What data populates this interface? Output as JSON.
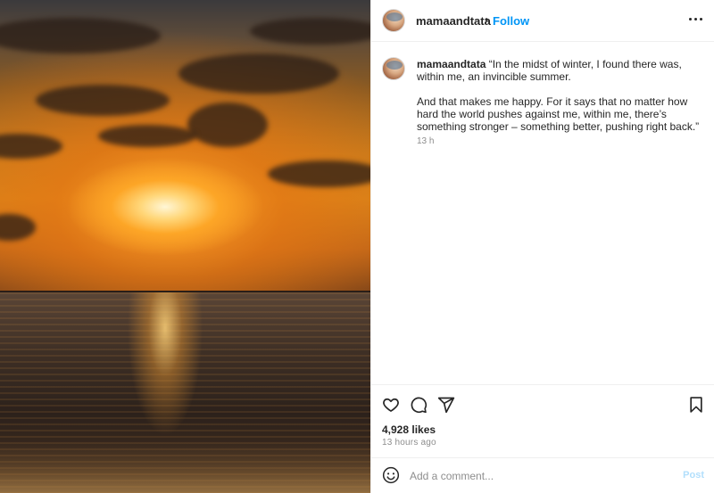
{
  "photo": {
    "alt": "Sunset over the ocean"
  },
  "header": {
    "username": "mamaandtata",
    "separator": "•",
    "follow_label": "Follow",
    "more_icon": "more-horizontal-icon"
  },
  "caption": {
    "username": "mamaandtata",
    "text": " “In the midst of winter, I found there was, within me, an invincible summer.\n\nAnd that makes me happy. For it says that no matter how hard the world pushes against me, within me, there’s something stronger – something better, pushing right back.”",
    "time": "13 h"
  },
  "actions": {
    "like_icon": "heart-icon",
    "comment_icon": "comment-icon",
    "share_icon": "share-icon",
    "save_icon": "bookmark-icon",
    "likes": "4,928 likes",
    "posted_ago": "13 hours ago"
  },
  "comment": {
    "emoji_icon": "emoji-icon",
    "placeholder": "Add a comment...",
    "post_label": "Post"
  },
  "colors": {
    "link": "#0095f6",
    "post_disabled": "#b2dffc",
    "text": "#262626",
    "muted": "#8e8e8e"
  }
}
